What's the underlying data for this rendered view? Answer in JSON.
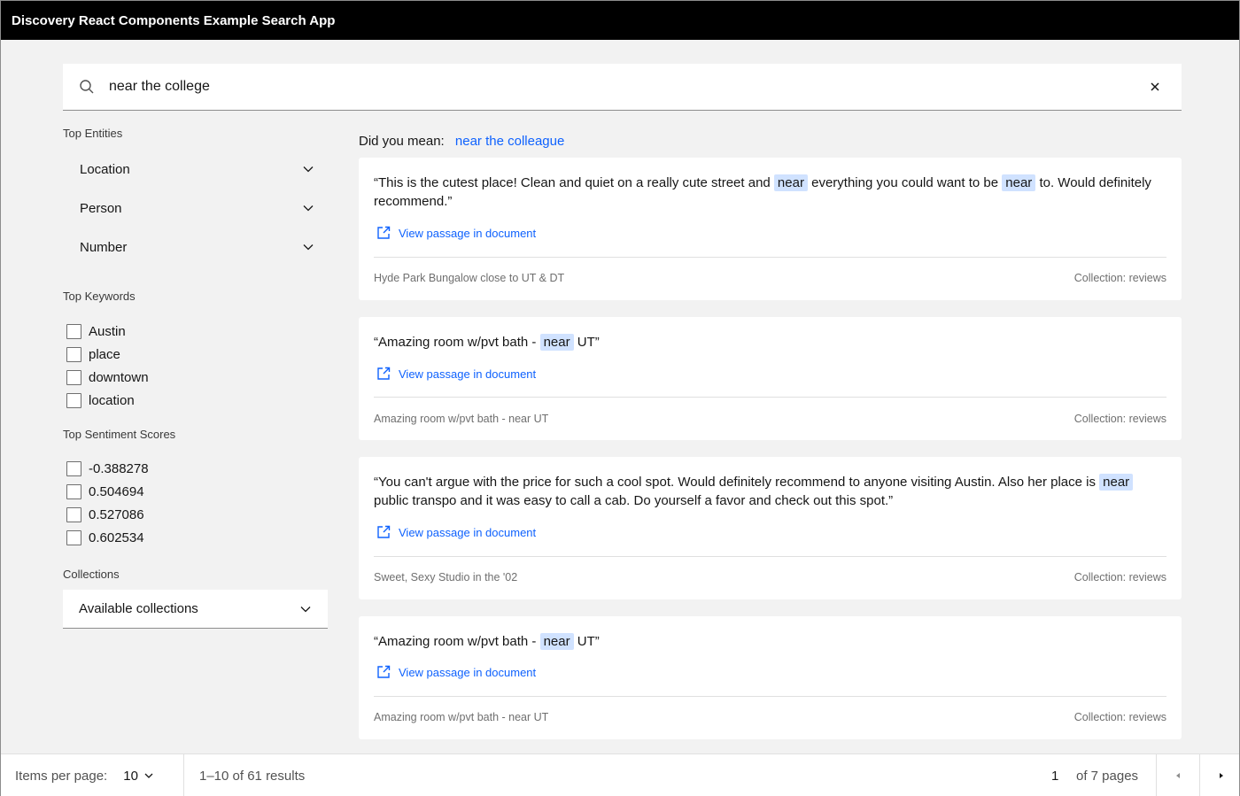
{
  "app": {
    "title": "Discovery React Components Example Search App"
  },
  "search": {
    "value": "near the college",
    "icons": {
      "search": "search-icon",
      "clear": "close-icon"
    }
  },
  "sidebar": {
    "top_entities": {
      "label": "Top Entities",
      "items": [
        {
          "label": "Location",
          "icon": "chevron-down-icon"
        },
        {
          "label": "Person",
          "icon": "chevron-down-icon"
        },
        {
          "label": "Number",
          "icon": "chevron-down-icon"
        }
      ]
    },
    "top_keywords": {
      "label": "Top Keywords",
      "items": [
        {
          "label": "Austin",
          "checked": false
        },
        {
          "label": "place",
          "checked": false
        },
        {
          "label": "downtown",
          "checked": false
        },
        {
          "label": "location",
          "checked": false
        }
      ]
    },
    "top_sentiment": {
      "label": "Top Sentiment Scores",
      "items": [
        {
          "label": "-0.388278",
          "checked": false
        },
        {
          "label": "0.504694",
          "checked": false
        },
        {
          "label": "0.527086",
          "checked": false
        },
        {
          "label": "0.602534",
          "checked": false
        }
      ]
    },
    "collections": {
      "label": "Collections",
      "select_value": "Available collections"
    }
  },
  "results": {
    "did_you_mean_label": "Did you mean:",
    "did_you_mean_suggestion": "near the colleague",
    "view_link_label": "View passage in document",
    "items": [
      {
        "passage": [
          {
            "text": "“This is the cutest place! Clean and quiet on a really cute street and "
          },
          {
            "text": "near",
            "hl": true
          },
          {
            "text": " everything you could want to be "
          },
          {
            "text": "near",
            "hl": true
          },
          {
            "text": " to. Would definitely recommend.”"
          }
        ],
        "title": "Hyde Park Bungalow close to UT & DT",
        "collection": "Collection: reviews"
      },
      {
        "passage": [
          {
            "text": "“Amazing room w/pvt bath - "
          },
          {
            "text": "near",
            "hl": true
          },
          {
            "text": " UT”"
          }
        ],
        "title": "Amazing room w/pvt bath - near UT",
        "collection": "Collection: reviews"
      },
      {
        "passage": [
          {
            "text": "“You can't argue with the price for such a cool spot. Would definitely recommend to anyone visiting Austin. Also her place is "
          },
          {
            "text": "near",
            "hl": true
          },
          {
            "text": " public transpo and it was easy to call a cab. Do yourself a favor and check out this spot.”"
          }
        ],
        "title": "Sweet, Sexy Studio in the '02",
        "collection": "Collection: reviews"
      },
      {
        "passage": [
          {
            "text": "“Amazing room w/pvt bath - "
          },
          {
            "text": "near",
            "hl": true
          },
          {
            "text": " UT”"
          }
        ],
        "title": "Amazing room w/pvt bath - near UT",
        "collection": "Collection: reviews"
      }
    ]
  },
  "pagination": {
    "items_per_page_label": "Items per page:",
    "items_per_page_value": "10",
    "range_text": "1–10 of 61 results",
    "current_page": "1",
    "of_pages_text": "of 7 pages"
  },
  "colors": {
    "accent": "#0f62fe",
    "highlight": "#d0e2ff",
    "topbar": "#000000",
    "background": "#f2f2f2"
  }
}
